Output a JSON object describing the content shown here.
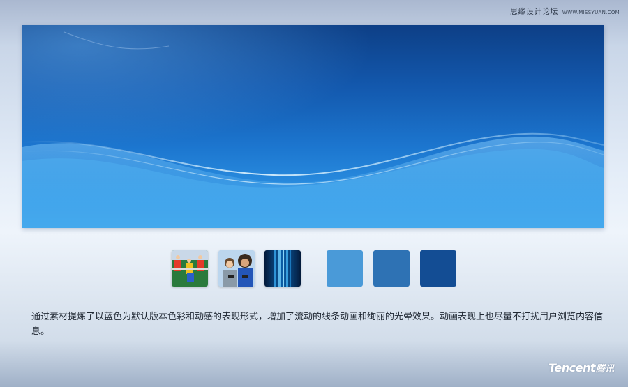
{
  "watermark": {
    "site_name": "思缘设计论坛",
    "url": "WWW.MISSYUAN.COM"
  },
  "banner": {
    "colors": {
      "top": "#0d3f86",
      "bottom": "#3aa0ea"
    }
  },
  "thumbnails": [
    {
      "name": "foosball-photo",
      "icon": "foosball-image"
    },
    {
      "name": "gamers-photo",
      "icon": "people-gaming-image"
    },
    {
      "name": "light-streaks",
      "icon": "light-rays-image"
    }
  ],
  "swatches": [
    {
      "name": "light-blue",
      "color": "#4a9ad8"
    },
    {
      "name": "medium-blue",
      "color": "#2e72b4"
    },
    {
      "name": "dark-blue",
      "color": "#134d94"
    }
  ],
  "description": "通过素材提炼了以蓝色为默认版本色彩和动感的表现形式，增加了流动的线条动画和绚丽的光晕效果。动画表现上也尽量不打扰用户浏览内容信息。",
  "brand": {
    "latin": "Tencent",
    "cn": "腾讯"
  }
}
